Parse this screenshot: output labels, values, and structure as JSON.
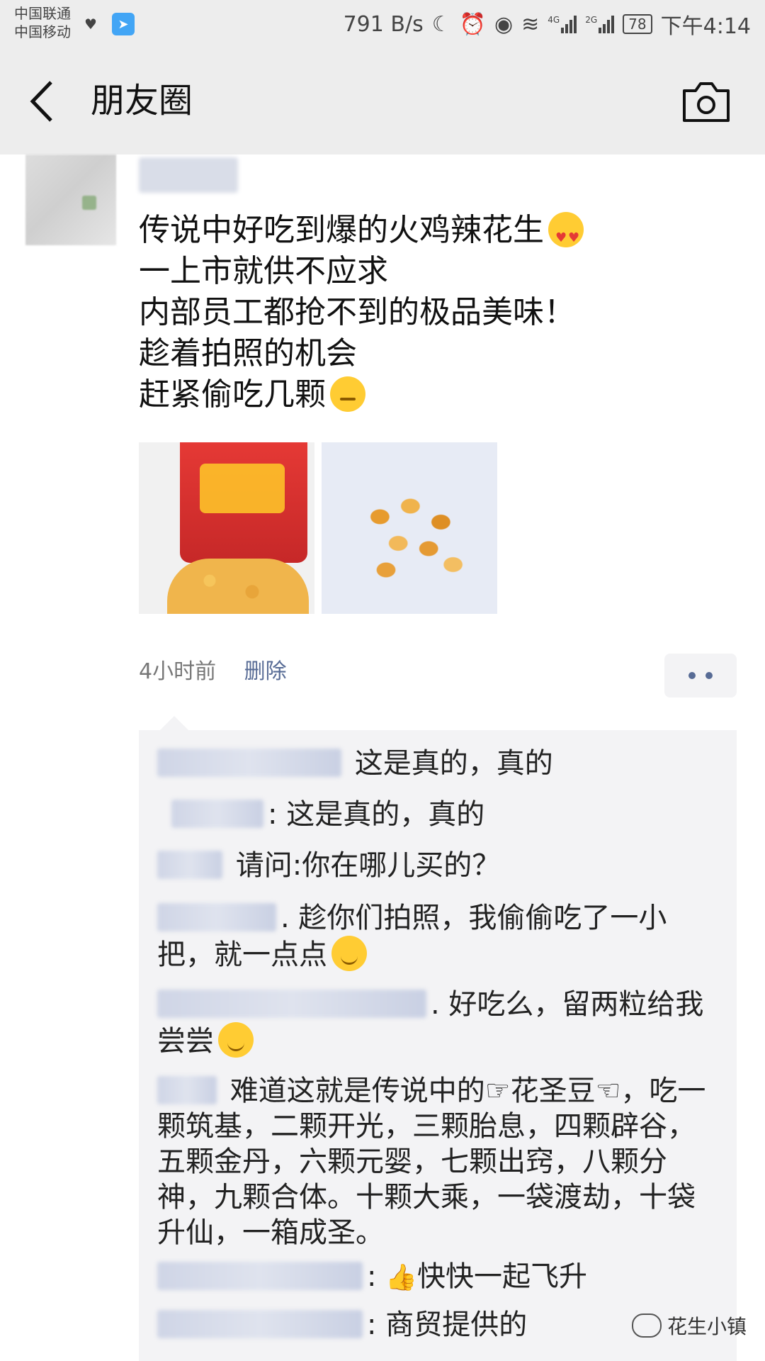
{
  "status_bar": {
    "carrier_1": "中国联通",
    "carrier_2": "中国移动",
    "net_speed": "791 B/s",
    "signal_1": "4G",
    "signal_2": "2G",
    "battery": "78",
    "time": "下午4:14"
  },
  "nav": {
    "title": "朋友圈"
  },
  "post": {
    "lines": [
      "传说中好吃到爆的火鸡辣花生",
      "一上市就供不应求",
      "内部员工都抢不到的极品美味！",
      "趁着拍照的机会",
      "赶紧偷吃几颗"
    ],
    "time": "4小时前",
    "delete_label": "删除"
  },
  "comments": [
    {
      "text": "这是真的，真的"
    },
    {
      "text": ": 这是真的，真的"
    },
    {
      "text": "请问:你在哪儿买的？"
    },
    {
      "text": ". 趁你们拍照，我偷偷吃了一小把，就一点点"
    },
    {
      "text": ". 好吃么，留两粒给我尝尝"
    },
    {
      "text": "难道这就是传说中的☞花圣豆☜，吃一颗筑基，二颗开光，三颗胎息，四颗辟谷，五颗金丹，六颗元婴，七颗出窍，八颗分神，九颗合体。十颗大乘，一袋渡劫，十袋升仙，一箱成圣。"
    },
    {
      "text": "快快一起飞升"
    },
    {
      "text": ": 商贸提供的"
    }
  ],
  "watermark": "花生小镇",
  "icons": {
    "back": "chevron-left-icon",
    "camera": "camera-icon",
    "more": "two-dots-icon"
  },
  "colors": {
    "link": "#576b95",
    "bar_bg": "#ededed",
    "comment_bg": "#f3f3f5"
  }
}
